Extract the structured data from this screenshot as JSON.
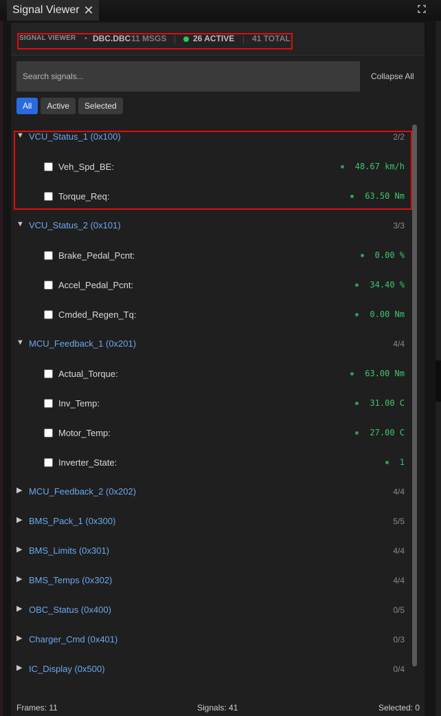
{
  "window": {
    "tab_title": "Signal Viewer",
    "close_glyph": "✕"
  },
  "header": {
    "title": "SIGNAL VIEWER",
    "dot": "•",
    "file": "DBC.DBC",
    "msgs": "11 MSGS",
    "active": "26 ACTIVE",
    "total": "41 TOTAL",
    "status_color": "#27c75a"
  },
  "search": {
    "placeholder": "Search signals..."
  },
  "collapse_label": "Collapse All",
  "filters": {
    "all": "All",
    "active": "Active",
    "selected": "Selected",
    "selected_filter": "All"
  },
  "groups": [
    {
      "name": "VCU_Status_1 (0x100)",
      "count": "2/2",
      "expanded": true,
      "signals": [
        {
          "name": "Veh_Spd_BE:",
          "value": "48.67 km/h"
        },
        {
          "name": "Torque_Req:",
          "value": "63.50 Nm"
        }
      ]
    },
    {
      "name": "VCU_Status_2 (0x101)",
      "count": "3/3",
      "expanded": true,
      "signals": [
        {
          "name": "Brake_Pedal_Pcnt:",
          "value": "0.00 %"
        },
        {
          "name": "Accel_Pedal_Pcnt:",
          "value": "34.40 %"
        },
        {
          "name": "Cmded_Regen_Tq:",
          "value": "0.00 Nm"
        }
      ]
    },
    {
      "name": "MCU_Feedback_1 (0x201)",
      "count": "4/4",
      "expanded": true,
      "signals": [
        {
          "name": "Actual_Torque:",
          "value": "63.00 Nm"
        },
        {
          "name": "Inv_Temp:",
          "value": "31.00 C"
        },
        {
          "name": "Motor_Temp:",
          "value": "27.00 C"
        },
        {
          "name": "Inverter_State:",
          "value": "1"
        }
      ]
    },
    {
      "name": "MCU_Feedback_2 (0x202)",
      "count": "4/4",
      "expanded": false
    },
    {
      "name": "BMS_Pack_1 (0x300)",
      "count": "5/5",
      "expanded": false
    },
    {
      "name": "BMS_Limits (0x301)",
      "count": "4/4",
      "expanded": false
    },
    {
      "name": "BMS_Temps (0x302)",
      "count": "4/4",
      "expanded": false
    },
    {
      "name": "OBC_Status (0x400)",
      "count": "0/5",
      "expanded": false
    },
    {
      "name": "Charger_Cmd (0x401)",
      "count": "0/3",
      "expanded": false
    },
    {
      "name": "IC_Display (0x500)",
      "count": "0/4",
      "expanded": false
    }
  ],
  "footer": {
    "frames": "Frames: 11",
    "signals": "Signals: 41",
    "selected": "Selected: 0"
  },
  "colors": {
    "accent": "#2a6ae0",
    "group_name": "#6aa8ee",
    "value_green": "#3ec46d",
    "highlight_box": "#e00d0d"
  }
}
